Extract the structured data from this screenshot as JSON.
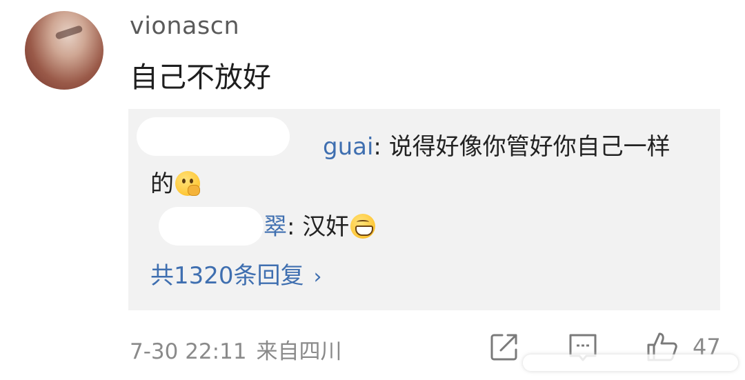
{
  "comment": {
    "username": "vionascn",
    "text": "自己不放好"
  },
  "replies": [
    {
      "name_suffix": "guai",
      "separator": ": ",
      "text": "说得好像你管好你自己一样的",
      "emoji": "thinking-emoji"
    },
    {
      "name_suffix": "翠",
      "separator": ": ",
      "text": "汉奸",
      "emoji": "grin-emoji"
    }
  ],
  "more_replies": {
    "label": "共1320条回复",
    "chevron": "›"
  },
  "footer": {
    "timestamp": "7-30 22:11",
    "location": "来自四川",
    "like_count": "47"
  },
  "icons": [
    "share-icon",
    "comment-icon",
    "like-icon"
  ],
  "colors": {
    "link_blue": "#3f6fb0",
    "reply_bg": "#f2f2f2",
    "meta_gray": "#8a8a8a"
  }
}
